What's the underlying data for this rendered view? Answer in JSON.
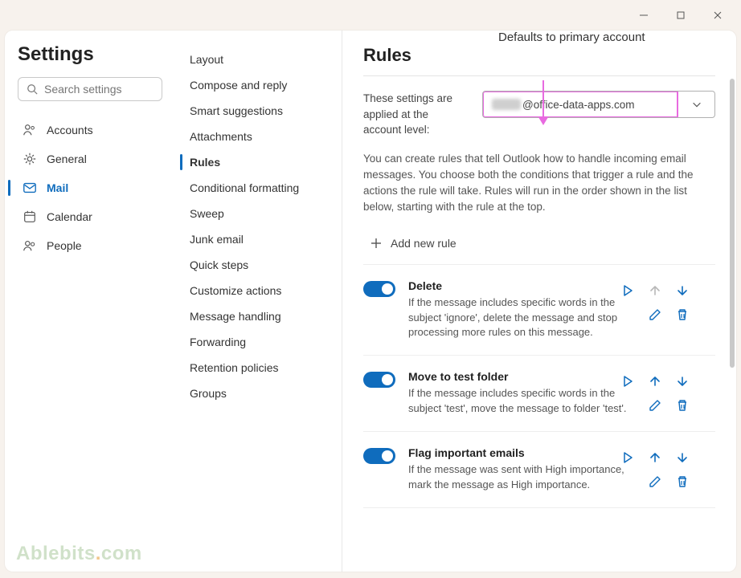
{
  "annotation": "Defaults to primary account",
  "window": {
    "title": ""
  },
  "settings_title": "Settings",
  "search": {
    "placeholder": "Search settings"
  },
  "categories": [
    {
      "id": "accounts",
      "label": "Accounts"
    },
    {
      "id": "general",
      "label": "General"
    },
    {
      "id": "mail",
      "label": "Mail",
      "active": true
    },
    {
      "id": "calendar",
      "label": "Calendar"
    },
    {
      "id": "people",
      "label": "People"
    }
  ],
  "mail_sections": [
    "Layout",
    "Compose and reply",
    "Smart suggestions",
    "Attachments",
    "Rules",
    "Conditional formatting",
    "Sweep",
    "Junk email",
    "Quick steps",
    "Customize actions",
    "Message handling",
    "Forwarding",
    "Retention policies",
    "Groups"
  ],
  "mail_active_index": 4,
  "panel": {
    "title": "Rules",
    "account_label": "These settings are applied at the account level:",
    "account_value": "@office-data-apps.com",
    "description": "You can create rules that tell Outlook how to handle incoming email messages. You choose both the conditions that trigger a rule and the actions the rule will take. Rules will run in the order shown in the list below, starting with the rule at the top.",
    "add_label": "Add new rule",
    "rules": [
      {
        "name": "Delete",
        "desc": "If the message includes specific words in the subject 'ignore', delete the message and stop processing more rules on this message.",
        "up_disabled": true
      },
      {
        "name": "Move to test folder",
        "desc": "If the message includes specific words in the subject 'test', move the message to folder 'test'."
      },
      {
        "name": "Flag important emails",
        "desc": "If the message was sent with High importance, mark the message as High importance."
      }
    ]
  },
  "watermark": "Ablebits.com"
}
